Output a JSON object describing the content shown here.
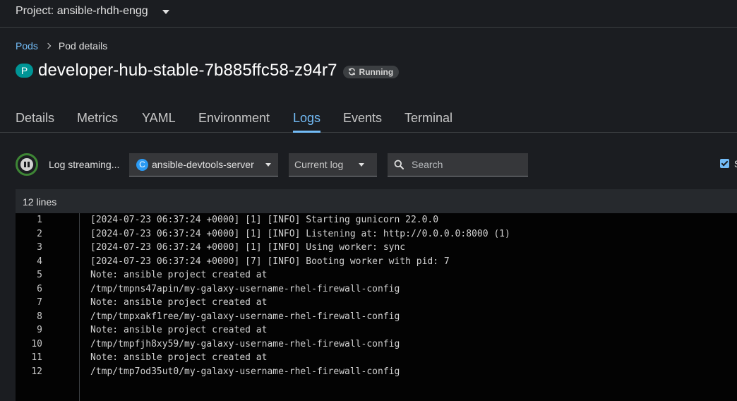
{
  "project": {
    "label": "Project: ansible-rhdh-engg"
  },
  "breadcrumb": {
    "parent": "Pods",
    "current": "Pod details"
  },
  "pod": {
    "badge": "P",
    "name": "developer-hub-stable-7b885ffc58-z94r7",
    "status": "Running"
  },
  "tabs": [
    {
      "label": "Details"
    },
    {
      "label": "Metrics"
    },
    {
      "label": "YAML"
    },
    {
      "label": "Environment"
    },
    {
      "label": "Logs"
    },
    {
      "label": "Events"
    },
    {
      "label": "Terminal"
    }
  ],
  "active_tab": "Logs",
  "toolbar": {
    "streaming_label": "Log streaming...",
    "container_badge": "C",
    "container_name": "ansible-devtools-server",
    "log_type": "Current log",
    "search_placeholder": "Search",
    "wrap_label": "S",
    "wrap_checked": true
  },
  "logs": {
    "count_label": "12 lines",
    "lines": [
      {
        "num": "1",
        "text": "[2024-07-23 06:37:24 +0000] [1] [INFO] Starting gunicorn 22.0.0"
      },
      {
        "num": "2",
        "text": "[2024-07-23 06:37:24 +0000] [1] [INFO] Listening at: http://0.0.0.0:8000 (1)"
      },
      {
        "num": "3",
        "text": "[2024-07-23 06:37:24 +0000] [1] [INFO] Using worker: sync"
      },
      {
        "num": "4",
        "text": "[2024-07-23 06:37:24 +0000] [7] [INFO] Booting worker with pid: 7"
      },
      {
        "num": "5",
        "text": "Note: ansible project created at"
      },
      {
        "num": "6",
        "text": "/tmp/tmpns47apin/my-galaxy-username-rhel-firewall-config"
      },
      {
        "num": "7",
        "text": "Note: ansible project created at"
      },
      {
        "num": "8",
        "text": "/tmp/tmpxakf1ree/my-galaxy-username-rhel-firewall-config"
      },
      {
        "num": "9",
        "text": "Note: ansible project created at"
      },
      {
        "num": "10",
        "text": "/tmp/tmpfjh8xy59/my-galaxy-username-rhel-firewall-config"
      },
      {
        "num": "11",
        "text": "Note: ansible project created at"
      },
      {
        "num": "12",
        "text": "/tmp/tmp7od35ut0/my-galaxy-username-rhel-firewall-config"
      }
    ]
  },
  "colors": {
    "accent": "#73bcf7",
    "running_ring": "#3e8635",
    "pod_badge": "#009596",
    "container_badge": "#2b9af3"
  }
}
